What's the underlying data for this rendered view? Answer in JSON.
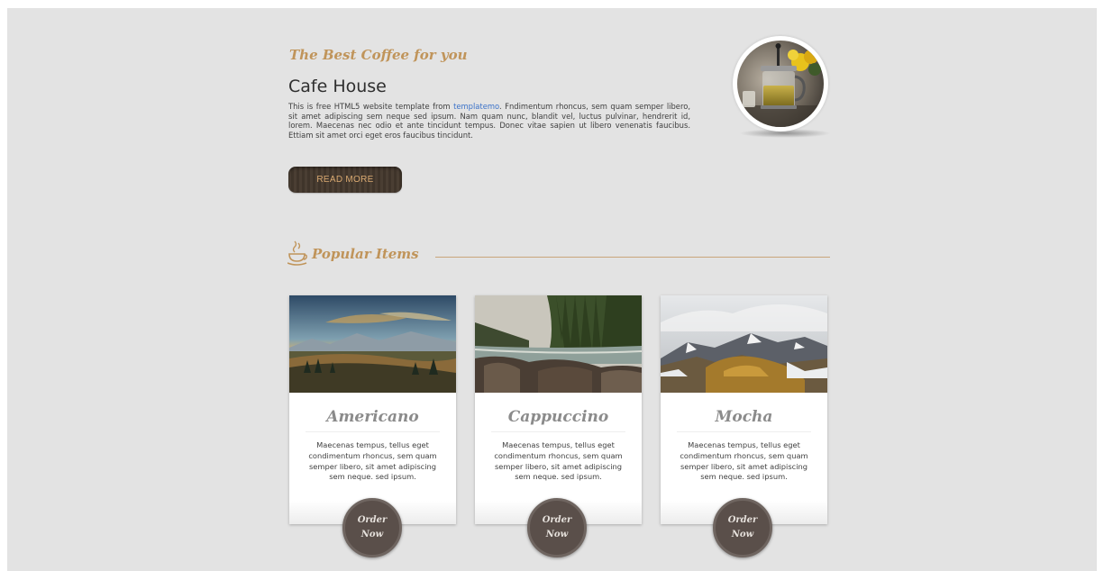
{
  "hero": {
    "tagline": "The Best Coffee for you",
    "title": "Cafe House",
    "description_pre": "This is free HTML5 website template from ",
    "description_link": "templatemo",
    "description_post": ". Fndimentum rhoncus, sem quam semper libero, sit amet adipiscing sem neque sed ipsum. Nam quam nunc, blandit vel, luctus pulvinar, hendrerit id, lorem. Maecenas nec odio et ante tincidunt tempus. Donec vitae sapien ut libero venenatis faucibus. Ettiam sit amet orci eget eros faucibus tincidunt.",
    "read_more_label": "READ MORE",
    "image_icon": "coffee-press-photo"
  },
  "section": {
    "title": "Popular Items",
    "icon": "coffee-cup-icon"
  },
  "items": [
    {
      "name": "Americano",
      "description": "Maecenas tempus, tellus eget condimentum rhoncus, sem quam semper libero, sit amet adipiscing sem neque. sed ipsum.",
      "order_line1": "Order",
      "order_line2": "Now"
    },
    {
      "name": "Cappuccino",
      "description": "Maecenas tempus, tellus eget condimentum rhoncus, sem quam semper libero, sit amet adipiscing sem neque. sed ipsum.",
      "order_line1": "Order",
      "order_line2": "Now"
    },
    {
      "name": "Mocha",
      "description": "Maecenas tempus, tellus eget condimentum rhoncus, sem quam semper libero, sit amet adipiscing sem neque. sed ipsum.",
      "order_line1": "Order",
      "order_line2": "Now"
    }
  ],
  "colors": {
    "accent": "#c0945a",
    "page_bg": "#e3e3e3",
    "button_dark": "#4a3e33",
    "order_button": "#5a4f4a",
    "link": "#3b72c9"
  }
}
